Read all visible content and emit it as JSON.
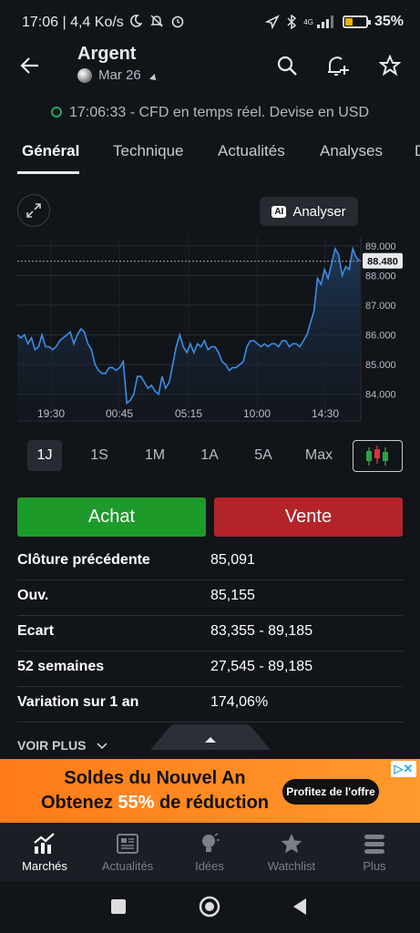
{
  "status_bar": {
    "time_speed": "17:06 | 4,4 Ko/s",
    "network": "4G",
    "battery": "35%",
    "battery_level": 0.35
  },
  "header": {
    "title": "Argent",
    "subtitle": "Mar 26",
    "info": "17:06:33 - CFD en temps réel. Devise en USD"
  },
  "tabs": [
    {
      "label": "Général"
    },
    {
      "label": "Technique"
    },
    {
      "label": "Actualités"
    },
    {
      "label": "Analyses"
    }
  ],
  "analyser": {
    "badge": "AI",
    "label": "Analyser"
  },
  "chart_data": {
    "type": "area",
    "x_labels": [
      "19:30",
      "00:45",
      "05:15",
      "10:00",
      "14:30"
    ],
    "y_ticks": [
      "89.000",
      "88.000",
      "87.000",
      "86.000",
      "85.000",
      "84.000"
    ],
    "y_tick_values": [
      89,
      88,
      87,
      86,
      85,
      84
    ],
    "ylim": [
      83.1,
      89.3
    ],
    "current_value": 88.48,
    "current_label": "88.480",
    "line_color": "#3a8ee6",
    "values": [
      86.0,
      85.9,
      86.0,
      85.7,
      85.9,
      85.5,
      85.6,
      86.0,
      85.6,
      85.6,
      85.5,
      85.6,
      85.8,
      85.9,
      86.0,
      86.1,
      85.7,
      86.0,
      86.2,
      86.1,
      85.7,
      85.5,
      85.0,
      84.8,
      84.7,
      84.7,
      84.9,
      84.9,
      84.8,
      84.9,
      85.1,
      83.7,
      83.8,
      84.0,
      84.6,
      84.6,
      84.4,
      84.2,
      84.3,
      84.1,
      84.0,
      84.6,
      84.2,
      84.4,
      85.0,
      85.6,
      86.0,
      85.6,
      85.4,
      85.7,
      85.4,
      85.7,
      85.6,
      85.8,
      85.5,
      85.6,
      85.6,
      85.4,
      85.1,
      85.0,
      84.8,
      84.9,
      84.9,
      85.0,
      85.1,
      85.6,
      85.8,
      85.8,
      85.7,
      85.6,
      85.7,
      85.6,
      85.7,
      85.7,
      85.6,
      85.8,
      85.8,
      85.6,
      85.7,
      85.7,
      85.6,
      85.8,
      86.0,
      86.4,
      86.8,
      87.9,
      87.7,
      88.2,
      87.9,
      88.4,
      88.9,
      88.7,
      88.0,
      88.3,
      88.2,
      88.9,
      88.6,
      88.5
    ]
  },
  "ranges": [
    {
      "label": "1J"
    },
    {
      "label": "1S"
    },
    {
      "label": "1M"
    },
    {
      "label": "1A"
    },
    {
      "label": "5A"
    },
    {
      "label": "Max"
    }
  ],
  "actions": {
    "buy": "Achat",
    "sell": "Vente"
  },
  "stats": [
    {
      "label": "Clôture précédente",
      "value": "85,091"
    },
    {
      "label": "Ouv.",
      "value": "85,155"
    },
    {
      "label": "Ecart",
      "value": "83,355 - 89,185"
    },
    {
      "label": "52 semaines",
      "value": "27,545 - 89,185"
    },
    {
      "label": "Variation sur 1 an",
      "value": "174,06%"
    }
  ],
  "voir_plus": "VOIR PLUS",
  "ad": {
    "line1": "Soldes du Nouvel An",
    "line2_pre": "Obtenez ",
    "line2_hl": "55%",
    "line2_post": " de réduction",
    "cta": "Profitez de l'offre"
  },
  "bottom_nav": [
    {
      "label": "Marchés"
    },
    {
      "label": "Actualités"
    },
    {
      "label": "Idées"
    },
    {
      "label": "Watchlist"
    },
    {
      "label": "Plus"
    }
  ]
}
